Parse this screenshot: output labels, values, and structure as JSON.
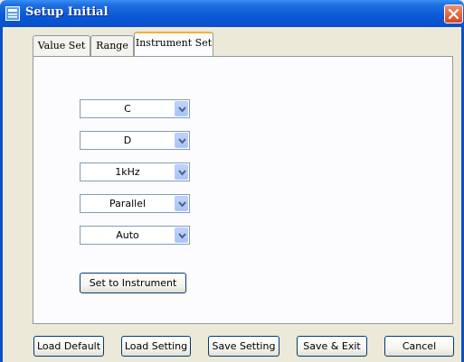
{
  "window": {
    "title": "Setup Initial",
    "accent_color": "#0b4fc8",
    "close_color": "#d6461c"
  },
  "tabs": [
    {
      "label": "Value Set",
      "active": false
    },
    {
      "label": "Range",
      "active": false
    },
    {
      "label": "Instrument Set",
      "active": true
    }
  ],
  "instrument_set": {
    "selects": [
      {
        "name": "primary-parameter",
        "value": "C"
      },
      {
        "name": "secondary-parameter",
        "value": "D"
      },
      {
        "name": "frequency",
        "value": "1kHz"
      },
      {
        "name": "circuit-mode",
        "value": "Parallel"
      },
      {
        "name": "range-mode",
        "value": "Auto"
      }
    ],
    "set_button": "Set to Instrument"
  },
  "footer": {
    "load_default": "Load Default",
    "load_setting": "Load Setting",
    "save_setting": "Save Setting",
    "save_exit": "Save & Exit",
    "cancel": "Cancel"
  }
}
